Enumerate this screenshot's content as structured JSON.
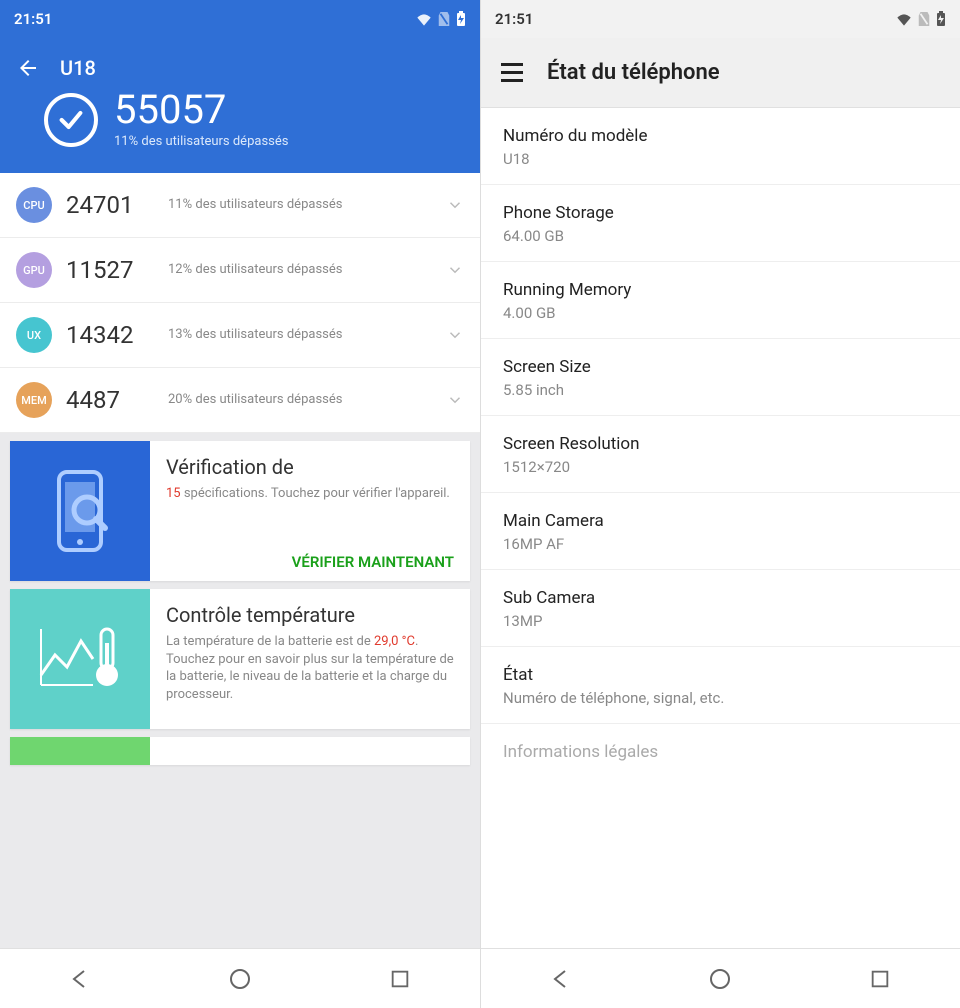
{
  "status": {
    "time": "21:51"
  },
  "left": {
    "title": "U18",
    "score": "55057",
    "score_sub": "11% des utilisateurs dépassés",
    "rows": [
      {
        "badge": "CPU",
        "badgeClass": "b-cpu",
        "score": "24701",
        "sub": "11% des utilisateurs dépassés"
      },
      {
        "badge": "GPU",
        "badgeClass": "b-gpu",
        "score": "11527",
        "sub": "12% des utilisateurs dépassés"
      },
      {
        "badge": "UX",
        "badgeClass": "b-ux",
        "score": "14342",
        "sub": "13% des utilisateurs dépassés"
      },
      {
        "badge": "MEM",
        "badgeClass": "b-mem",
        "score": "4487",
        "sub": "20% des utilisateurs dépassés"
      }
    ],
    "card1": {
      "title": "Vérification de",
      "count": "15",
      "text": " spécifications. Touchez pour vérifier l'appareil.",
      "action": "VÉRIFIER MAINTENANT"
    },
    "card2": {
      "title": "Contrôle température",
      "t_pre": "La température de la batterie est de ",
      "t_hl": "29,0 °C",
      "t_post": ". Touchez pour en savoir plus sur la température de la batterie, le niveau de la batterie et la charge du processeur."
    }
  },
  "right": {
    "title": "État du téléphone",
    "rows": [
      {
        "k": "Numéro du modèle",
        "v": "U18"
      },
      {
        "k": "Phone Storage",
        "v": "64.00 GB"
      },
      {
        "k": "Running Memory",
        "v": "4.00 GB"
      },
      {
        "k": "Screen Size",
        "v": "5.85 inch"
      },
      {
        "k": "Screen Resolution",
        "v": "1512×720"
      },
      {
        "k": "Main Camera",
        "v": "16MP AF"
      },
      {
        "k": "Sub Camera",
        "v": "13MP"
      },
      {
        "k": "État",
        "v": "Numéro de téléphone, signal, etc."
      }
    ],
    "partial": "Informations légales"
  }
}
